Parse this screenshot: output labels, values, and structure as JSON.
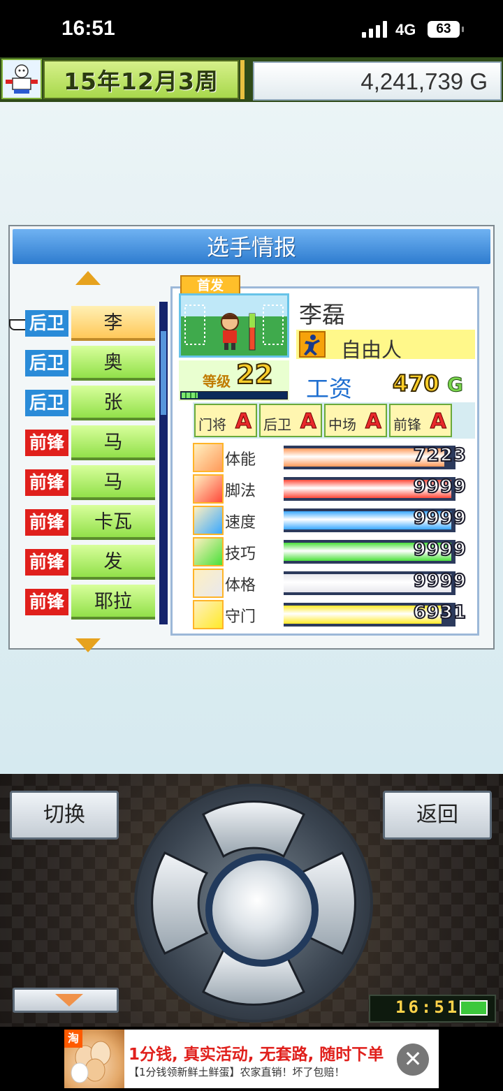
{
  "status_bar": {
    "time": "16:51",
    "network": "4G",
    "battery": "63"
  },
  "header": {
    "date": "15年12月3周",
    "money": "4,241,739 G"
  },
  "panel": {
    "title": "选手情报"
  },
  "roster": [
    {
      "position": "后卫",
      "name": "李",
      "selected": true
    },
    {
      "position": "后卫",
      "name": "奥",
      "selected": false
    },
    {
      "position": "后卫",
      "name": "张",
      "selected": false
    },
    {
      "position": "前锋",
      "name": "马",
      "selected": false
    },
    {
      "position": "前锋",
      "name": "马",
      "selected": false
    },
    {
      "position": "前锋",
      "name": "卡瓦",
      "selected": false
    },
    {
      "position": "前锋",
      "name": "发",
      "selected": false
    },
    {
      "position": "前锋",
      "name": "耶拉",
      "selected": false
    }
  ],
  "player": {
    "tag": "首发",
    "name": "李磊",
    "status": "自由人",
    "level_label": "等级",
    "level": "22",
    "exp_fraction": 0.15,
    "salary_label": "工资",
    "salary": "470",
    "salary_unit": "G",
    "aptitudes": [
      {
        "label": "门将",
        "grade": "A"
      },
      {
        "label": "后卫",
        "grade": "A"
      },
      {
        "label": "中场",
        "grade": "A"
      },
      {
        "label": "前锋",
        "grade": "A"
      }
    ],
    "stats": [
      {
        "label": "体能",
        "value": "7223",
        "level": 0.96,
        "color": "#ff9a5a"
      },
      {
        "label": "脚法",
        "value": "9999",
        "level": 1.0,
        "color": "#ff4a3a"
      },
      {
        "label": "速度",
        "value": "9999",
        "level": 1.0,
        "color": "#3aa8ff"
      },
      {
        "label": "技巧",
        "value": "9999",
        "level": 1.0,
        "color": "#4ae03a"
      },
      {
        "label": "体格",
        "value": "9999",
        "level": 1.0,
        "color": "#e8e8ee"
      },
      {
        "label": "守门",
        "value": "6931",
        "level": 0.94,
        "color": "#ffea2a"
      }
    ]
  },
  "controls": {
    "switch_label": "切换",
    "back_label": "返回",
    "game_time": "16:51"
  },
  "ad": {
    "tag": "淘",
    "title": "1分钱, 真实活动, 无套路, 随时下单",
    "subtitle": "【1分钱领新鲜土鲜蛋】农家直销！坏了包赔！",
    "close": "✕"
  }
}
